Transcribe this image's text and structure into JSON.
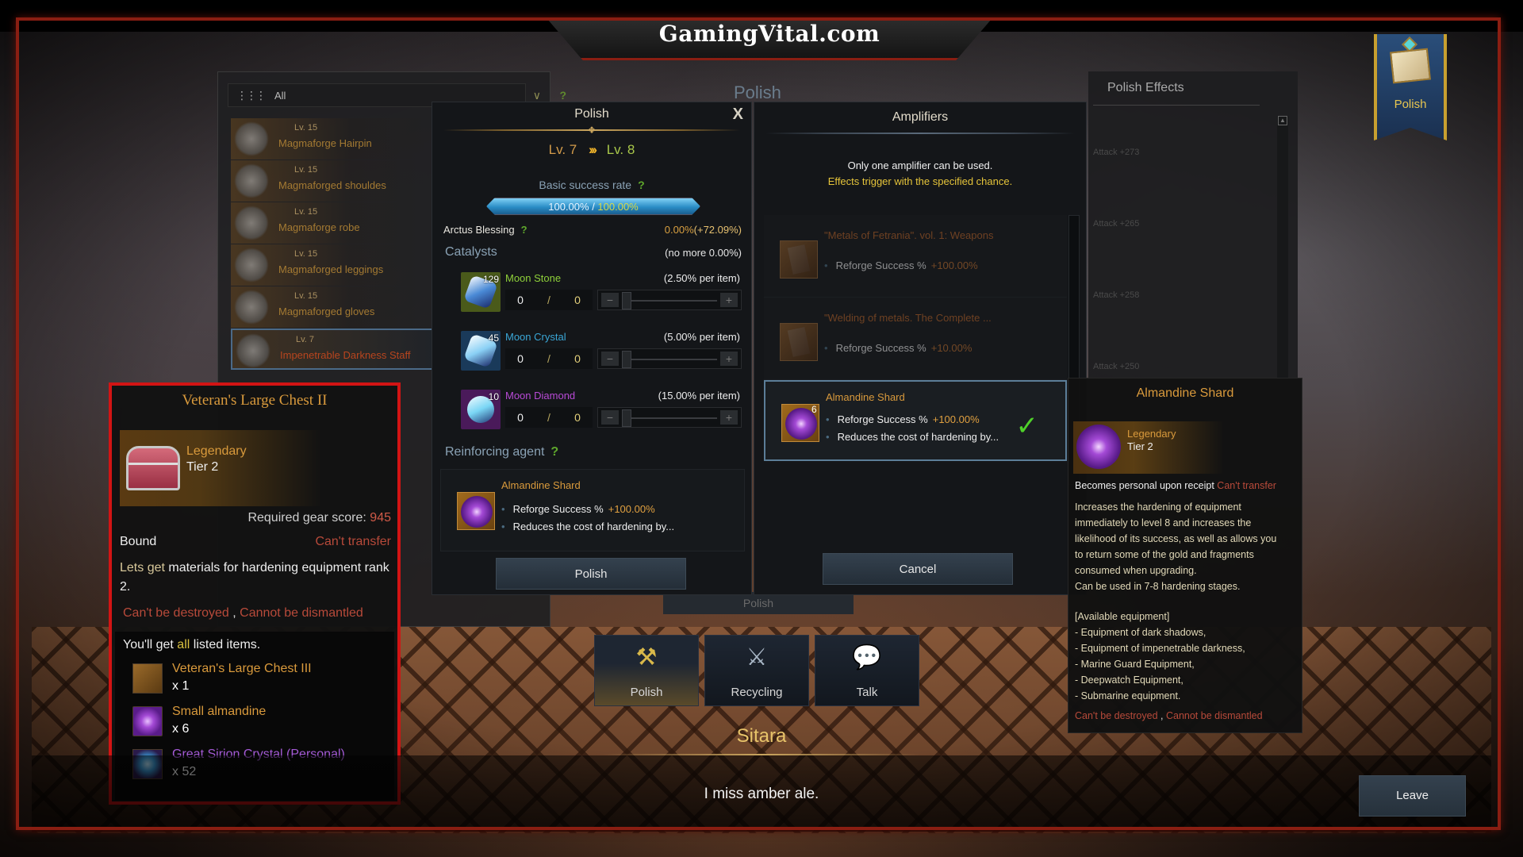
{
  "watermark": "GamingVital.com",
  "background_panel": {
    "title": "Polish",
    "bottom_button": "Polish"
  },
  "inventory": {
    "filter_label": "All",
    "items": [
      {
        "level": "Lv. 15",
        "name": "Magmaforge Hairpin"
      },
      {
        "level": "Lv. 15",
        "name": "Magmaforged shouldes"
      },
      {
        "level": "Lv. 15",
        "name": "Magmaforge robe"
      },
      {
        "level": "Lv. 15",
        "name": "Magmaforged leggings"
      },
      {
        "level": "Lv. 15",
        "name": "Magmaforged gloves"
      },
      {
        "level": "Lv. 7",
        "name": "Impenetrable Darkness Staff",
        "selected": true
      }
    ]
  },
  "polish": {
    "title": "Polish",
    "close": "X",
    "level_from": "Lv. 7",
    "level_arrows": "›››",
    "level_to": "Lv. 8",
    "basic_rate_label": "Basic success rate",
    "help": "?",
    "rate_current": "100.00%",
    "rate_sep": " / ",
    "rate_max": "100.00%",
    "rate_fraction": 1.0,
    "blessing_label": "Arctus Blessing",
    "blessing_value": "0.00%",
    "blessing_bonus": "(+72.09%)",
    "catalysts_title": "Catalysts",
    "catalysts_note": "(no more 0.00%)",
    "catalysts": [
      {
        "name": "Moon Stone",
        "owned": "129",
        "rate": "(2.50% per item)",
        "current": "0",
        "sep": "/",
        "max": "0",
        "color": "#8fd13a",
        "bg": "#4a5a1a",
        "gem": "#4a8ad6"
      },
      {
        "name": "Moon Crystal",
        "owned": "45",
        "rate": "(5.00% per item)",
        "current": "0",
        "sep": "/",
        "max": "0",
        "color": "#3aa6d6",
        "bg": "#1a3a5a",
        "gem": "#8ad0f5"
      },
      {
        "name": "Moon Diamond",
        "owned": "10",
        "rate": "(15.00% per item)",
        "current": "0",
        "sep": "/",
        "max": "0",
        "color": "#b84ad6",
        "bg": "#4a1a5a",
        "gem": "#7ad6f5"
      }
    ],
    "reinforcing_title": "Reinforcing agent",
    "reinforcing": {
      "name": "Almandine Shard",
      "effect1": "Reforge Success %",
      "effect1_value": "+100.00%",
      "effect2": "Reduces the cost of hardening by..."
    },
    "button": "Polish"
  },
  "amplifiers": {
    "title": "Amplifiers",
    "note1": "Only one amplifier can be used.",
    "note2": "Effects trigger with the specified chance.",
    "items": [
      {
        "name": "\"Metals of Fetrania\". vol. 1: Weapons",
        "effect": "Reforge Success %",
        "value": "+100.00%"
      },
      {
        "name": "\"Welding of metals. The Complete ...",
        "effect": "Reforge Success %",
        "value": "+10.00%"
      }
    ],
    "selected": {
      "name": "Almandine Shard",
      "qty": "6",
      "effect1": "Reforge Success %",
      "effect1_value": "+100.00%",
      "effect2": "Reduces the cost of hardening by..."
    },
    "cancel": "Cancel"
  },
  "effects": {
    "title": "Polish Effects",
    "entries": [
      "Attack +273",
      "Attack +265",
      "Attack +258",
      "Attack +250"
    ]
  },
  "almandine_tooltip": {
    "title": "Almandine Shard",
    "grade": "Legendary",
    "tier": "Tier 2",
    "binding": "Becomes personal upon receipt",
    "transfer": "Can't transfer",
    "description": [
      "Increases the hardening of equipment",
      "immediately to level 8 and increases the",
      "likelihood of its success, as well as allows you",
      "to return some of the gold and fragments",
      "consumed when upgrading.",
      "Can be used in 7-8 hardening stages."
    ],
    "available_title": "[Available equipment]",
    "available": [
      "-  Equipment of dark shadows,",
      "- Equipment of impenetrable darkness,",
      "- Marine Guard Equipment,",
      "- Deepwatch Equipment,",
      "- Submarine equipment."
    ],
    "warn1": "Can't be destroyed",
    "warn_sep": " , ",
    "warn2": "Cannot be dismantled"
  },
  "chest_tooltip": {
    "title": "Veteran's Large Chest II",
    "grade": "Legendary",
    "tier": "Tier 2",
    "req_label": "Required gear score: ",
    "req_value": "945",
    "bound": "Bound",
    "transfer": "Can't transfer",
    "desc_hl": "Lets get ",
    "desc": " materials for hardening equipment rank 2.",
    "warn1": "Can't be destroyed",
    "warn_sep": " , ",
    "warn2": "Cannot be dismantled",
    "get_prefix": "You'll get ",
    "get_all": "all",
    "get_suffix": " listed items.",
    "rewards": [
      {
        "name": "Veteran's Large Chest III",
        "qty": "x 1",
        "color": "#d99a3c"
      },
      {
        "name": "Small almandine",
        "qty": "x 6",
        "color": "#d99a3c"
      },
      {
        "name": "Great Sirion Crystal (Personal)",
        "qty": "x 52",
        "color": "#a45ad6"
      }
    ]
  },
  "npc": {
    "menu": [
      {
        "label": "Polish",
        "icon": "hammer-icon",
        "glyph": "⚒",
        "active": true
      },
      {
        "label": "Recycling",
        "icon": "sword-sparkle-icon",
        "glyph": "⚔",
        "active": false
      },
      {
        "label": "Talk",
        "icon": "talk-icon",
        "glyph": "💬",
        "active": false
      }
    ],
    "name": "Sitara",
    "dialog": "I miss amber ale.",
    "leave": "Leave"
  },
  "banner": {
    "label": "Polish"
  }
}
